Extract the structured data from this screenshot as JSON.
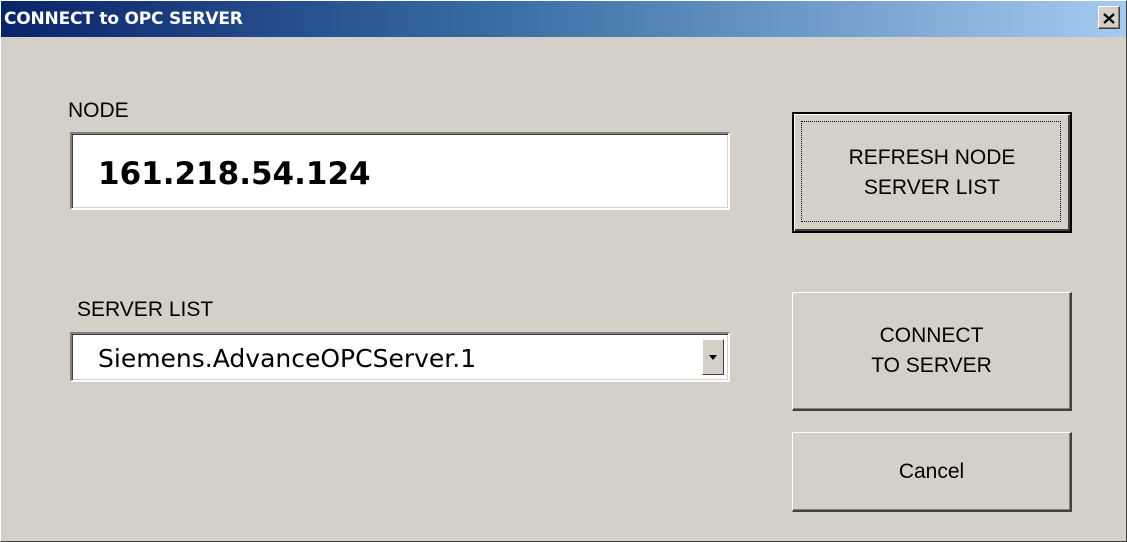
{
  "window": {
    "title": "CONNECT to OPC SERVER",
    "close_glyph": "✕",
    "close_icon": "close-icon"
  },
  "node": {
    "label": "NODE",
    "value": "161.218.54.124"
  },
  "server_list": {
    "label": "SERVER LIST",
    "selected": "Siemens.AdvanceOPCServer.1",
    "dropdown_icon": "chevron-down-icon"
  },
  "buttons": {
    "refresh": "REFRESH  NODE\nSERVER  LIST",
    "connect": "CONNECT\nTO SERVER",
    "cancel": "Cancel"
  },
  "colors": {
    "titlebar_start": "#0a246a",
    "titlebar_end": "#a6caf0",
    "face": "#d4d0c8"
  }
}
